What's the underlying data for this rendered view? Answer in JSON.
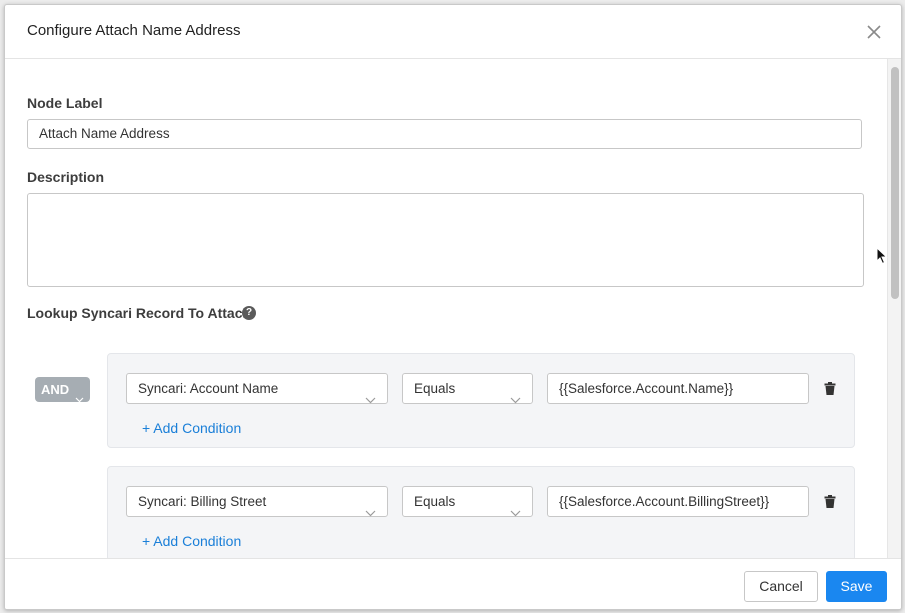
{
  "dialog": {
    "title": "Configure Attach Name Address",
    "close_icon": "close-icon"
  },
  "form": {
    "node_label": {
      "label": "Node Label",
      "value": "Attach Name Address"
    },
    "description": {
      "label": "Description",
      "value": ""
    },
    "lookup": {
      "label": "Lookup Syncari Record To Attach",
      "help_icon": "help-icon",
      "help_glyph": "?"
    },
    "operator": "AND",
    "conditions": [
      {
        "field": "Syncari: Account Name",
        "comparator": "Equals",
        "value": "{{Salesforce.Account.Name}}",
        "add_label": "+ Add Condition"
      },
      {
        "field": "Syncari: Billing Street",
        "comparator": "Equals",
        "value": "{{Salesforce.Account.BillingStreet}}",
        "add_label": "+ Add Condition"
      }
    ]
  },
  "footer": {
    "cancel_label": "Cancel",
    "save_label": "Save"
  },
  "colors": {
    "primary": "#1a87f0",
    "link": "#1a7fd8",
    "operator_badge": "#a6adb3",
    "group_bg": "#f4f5f7"
  }
}
